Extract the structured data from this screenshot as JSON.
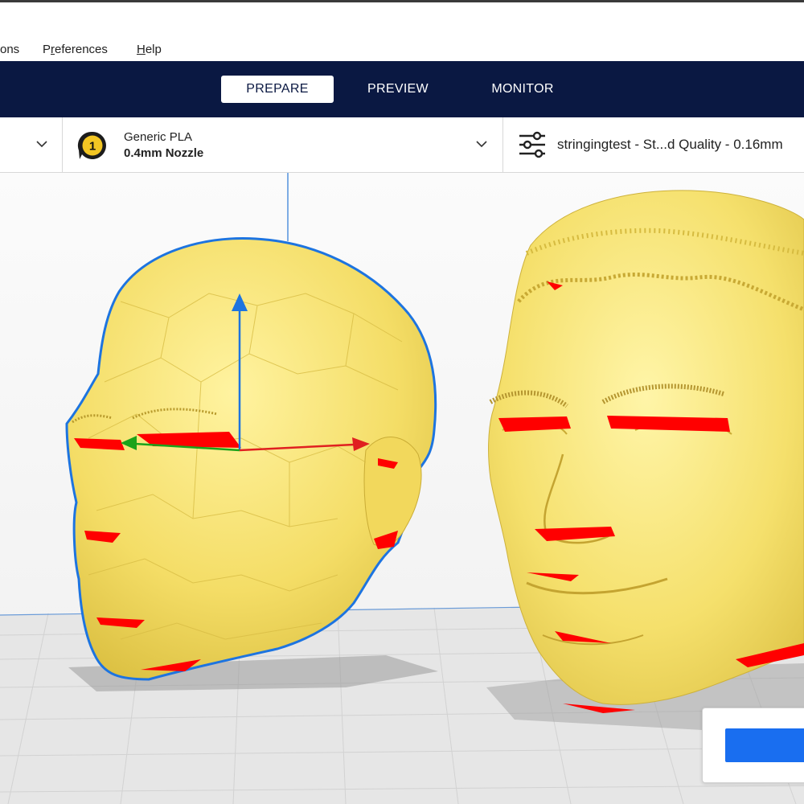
{
  "menu": {
    "items": [
      {
        "label": "ons",
        "accel_index": -1
      },
      {
        "label": "Preferences",
        "accel_index": 1
      },
      {
        "label": "Help",
        "accel_index": 0
      }
    ]
  },
  "stages": {
    "prepare": "PREPARE",
    "preview": "PREVIEW",
    "monitor": "MONITOR",
    "active": "prepare"
  },
  "material": {
    "extruder_number": "1",
    "name": "Generic PLA",
    "nozzle": "0.4mm Nozzle"
  },
  "print_settings": {
    "profile": "stringingtest - St...d Quality - 0.16mm"
  },
  "colors": {
    "stage_bar": "#0a1842",
    "model_fill": "#f7e26b",
    "overhang": "#ff0000",
    "selection_outline": "#1a73e8",
    "primary_button": "#196ef0",
    "build_plate": "#e4e4e4"
  }
}
